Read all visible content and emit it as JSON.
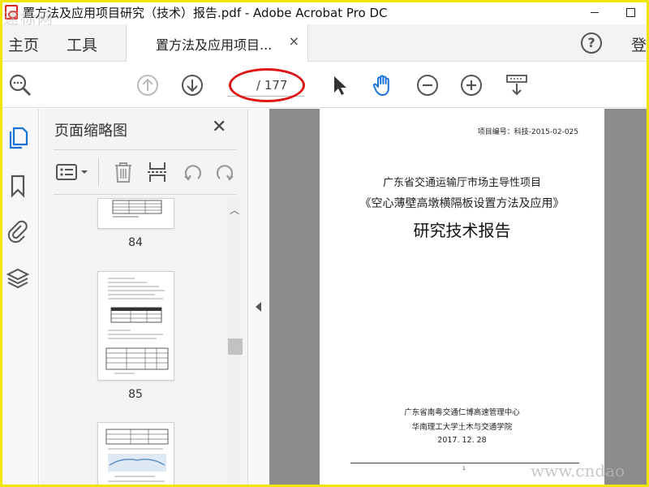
{
  "window": {
    "title": "置方法及应用项目研究（技术）报告.pdf - Adobe Acrobat Pro DC",
    "watermark_top": "速标网",
    "watermark_bottom": "www.cndao"
  },
  "menu": {
    "home": "主页",
    "tools": "工具",
    "login": "登"
  },
  "tab": {
    "label": "置方法及应用项目...",
    "close": "×"
  },
  "toolbar": {
    "page_current": "",
    "page_total": "/ 177"
  },
  "thumbnails_panel": {
    "title": "页面缩略图",
    "close": "✕",
    "pages": [
      {
        "number": "84"
      },
      {
        "number": "85"
      }
    ]
  },
  "document": {
    "project_no": "项目编号：科技-2015-02-025",
    "line1": "广东省交通运输厅市场主导性项目",
    "line2": "《空心薄壁高墩横隔板设置方法及应用》",
    "line3": "研究技术报告",
    "org1": "广东省南粤交通仁博高速管理中心",
    "org2": "华南理工大学土木与交通学院",
    "date": "2017. 12. 28",
    "page_mark": "1"
  },
  "colors": {
    "accent_red": "#e01515",
    "frame_yellow": "#f2e600",
    "hand_tool_blue": "#1a73d9"
  }
}
